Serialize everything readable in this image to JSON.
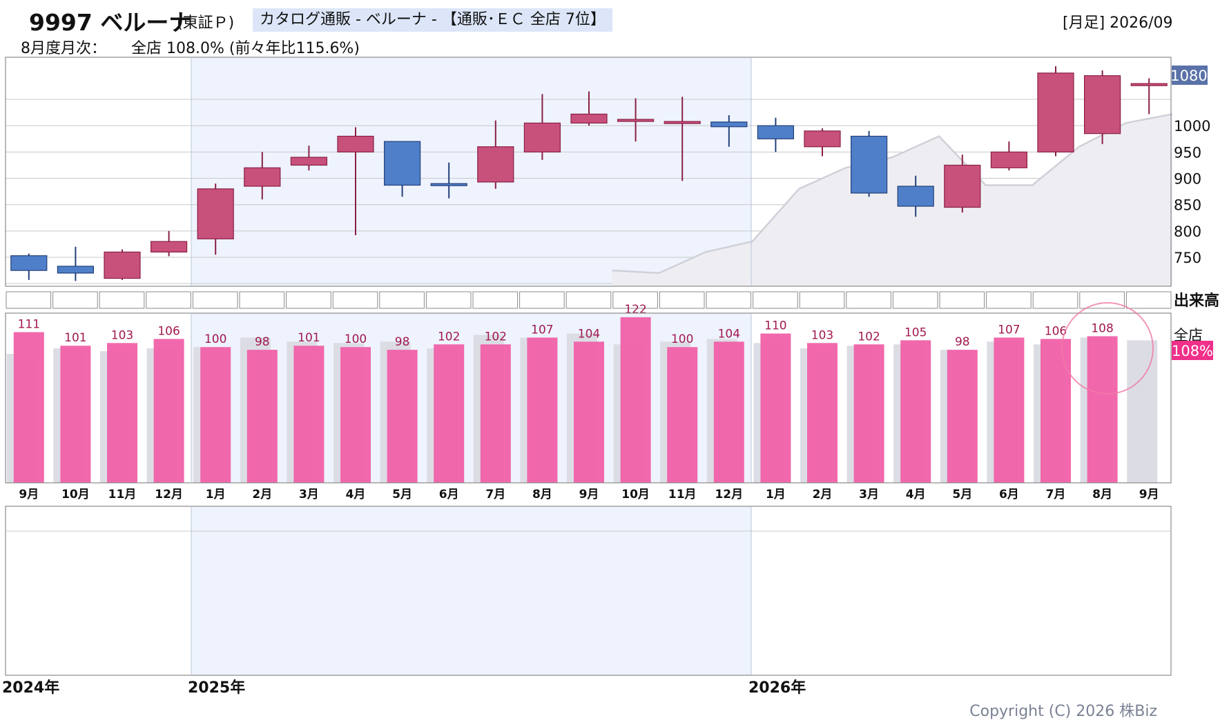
{
  "header": {
    "code_name": "9997 ベルーナ",
    "market": "(東証Ｐ)",
    "category": "カタログ通販 - ベルーナ - 【通販･ＥＣ 全店 7位】",
    "period": "[月足] 2026/09",
    "monthly_label": "8月度月次：",
    "monthly_value": "全店 108.0% (前々年比115.6%)"
  },
  "years": [
    "2024年",
    "2025年",
    "2026年"
  ],
  "volume_label": "出来高",
  "store_label": "全店",
  "store_value_label": "108%",
  "copyright": "Copyright (C) 2026 株Biz",
  "colors": {
    "up": "#c8517c",
    "down": "#4f7fc9",
    "bar": "#f060a8",
    "bar_prev": "#dcdde4",
    "label": "#a0184f",
    "shade": "#eef3fd",
    "current_price": "#5a72a8",
    "store_badge": "#f0308a"
  },
  "chart_data": [
    {
      "type": "candlestick",
      "categories": [
        "9月",
        "10月",
        "11月",
        "12月",
        "1月",
        "2月",
        "3月",
        "4月",
        "5月",
        "6月",
        "7月",
        "8月",
        "9月",
        "10月",
        "11月",
        "12月",
        "1月",
        "2月",
        "3月",
        "4月",
        "5月",
        "6月",
        "7月",
        "8月",
        "9月"
      ],
      "open": [
        753,
        733,
        710,
        760,
        785,
        885,
        925,
        950,
        970,
        890,
        893,
        950,
        1005,
        1012,
        1005,
        1007,
        1000,
        960,
        980,
        885,
        845,
        920,
        950,
        985,
        1080
      ],
      "high": [
        757,
        770,
        765,
        800,
        890,
        950,
        962,
        997,
        970,
        930,
        1010,
        1060,
        1065,
        1052,
        1055,
        1020,
        1015,
        995,
        990,
        905,
        945,
        970,
        1113,
        1105,
        1090
      ],
      "low": [
        707,
        705,
        707,
        752,
        755,
        860,
        915,
        792,
        865,
        862,
        880,
        935,
        1000,
        970,
        895,
        960,
        950,
        942,
        865,
        827,
        835,
        915,
        942,
        965,
        1022
      ],
      "close": [
        725,
        720,
        760,
        780,
        880,
        920,
        940,
        980,
        887,
        887,
        960,
        1005,
        1022,
        1012,
        1008,
        998,
        975,
        990,
        872,
        847,
        925,
        950,
        1100,
        1095,
        1080
      ],
      "yticks": [
        750,
        800,
        850,
        900,
        950,
        1000
      ],
      "current_price": "1080",
      "ylim": [
        695,
        1130
      ],
      "band": [
        null,
        null,
        null,
        null,
        null,
        null,
        null,
        null,
        null,
        null,
        null,
        null,
        null,
        725,
        720,
        760,
        780,
        880,
        920,
        940,
        980,
        887,
        887,
        960,
        1005,
        1022
      ]
    },
    {
      "type": "bar",
      "categories": [
        "9月",
        "10月",
        "11月",
        "12月",
        "1月",
        "2月",
        "3月",
        "4月",
        "5月",
        "6月",
        "7月",
        "8月",
        "9月",
        "10月",
        "11月",
        "12月",
        "1月",
        "2月",
        "3月",
        "4月",
        "5月",
        "6月",
        "7月",
        "8月",
        "9月"
      ],
      "series": [
        {
          "values": [
            111,
            101,
            103,
            106,
            100,
            98,
            101,
            100,
            98,
            102,
            102,
            107,
            104,
            122,
            100,
            104,
            110,
            103,
            102,
            105,
            98,
            107,
            106,
            108,
            null
          ]
        },
        {
          "values": [
            95,
            99,
            97,
            99,
            100,
            107,
            104,
            103,
            104,
            99,
            109,
            107,
            110,
            102,
            104,
            106,
            103,
            99,
            101,
            102,
            98,
            104,
            102,
            107,
            105
          ]
        }
      ],
      "ylim": [
        0,
        125
      ]
    }
  ]
}
